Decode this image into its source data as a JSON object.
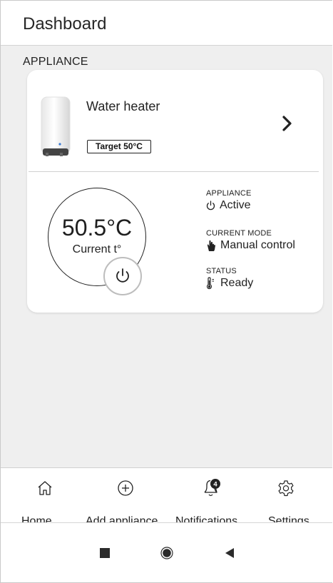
{
  "header": {
    "title": "Dashboard"
  },
  "section": {
    "label": "APPLIANCE"
  },
  "appliance": {
    "name": "Water heater",
    "target_badge": "Target 50°C",
    "current_temperature": "50.5°C",
    "current_label": "Current t°",
    "info": [
      {
        "label": "APPLIANCE",
        "value": "Active",
        "icon": "power-icon"
      },
      {
        "label": "CURRENT MODE",
        "value": "Manual control",
        "icon": "hand-icon"
      },
      {
        "label": "STATUS",
        "value": "Ready",
        "icon": "thermometer-icon"
      }
    ]
  },
  "bottom_nav": {
    "items": [
      {
        "label": "Home",
        "icon": "home-icon"
      },
      {
        "label": "Add appliance",
        "icon": "add-circle-icon"
      },
      {
        "label": "Notifications",
        "icon": "bell-icon",
        "badge": "4"
      },
      {
        "label": "Settings",
        "icon": "gear-icon"
      }
    ]
  },
  "system_nav": {
    "icons": [
      "recents-square-icon",
      "home-circle-icon",
      "back-triangle-icon"
    ]
  },
  "colors": {
    "background": "#efefef",
    "card": "#ffffff",
    "text": "#222222",
    "badge": "#222222"
  }
}
